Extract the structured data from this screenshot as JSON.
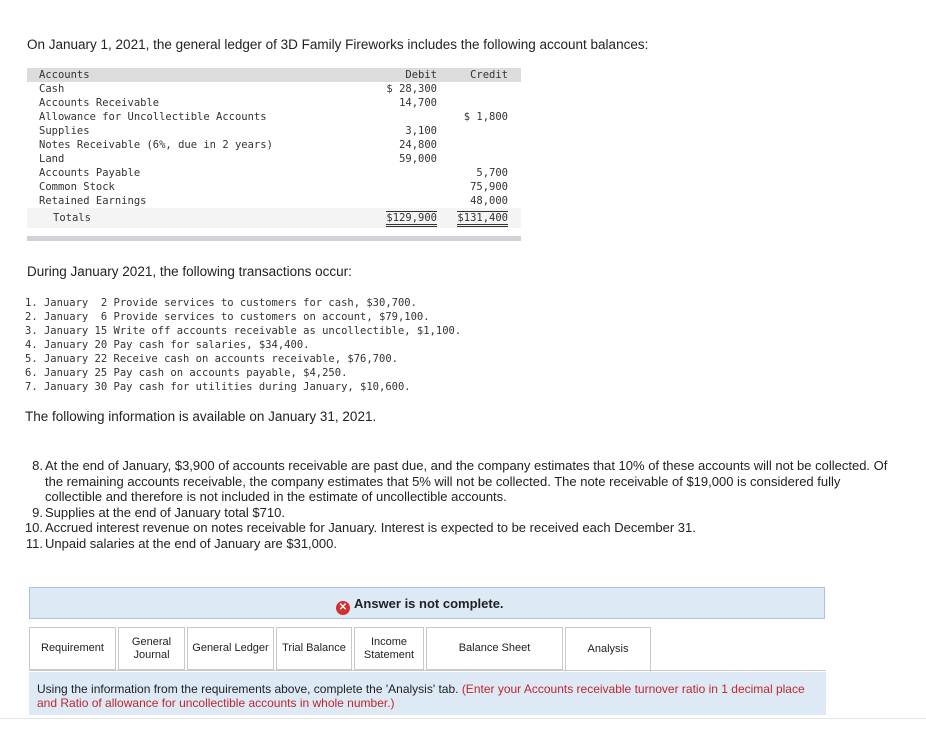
{
  "intro": "On January 1, 2021, the general ledger of 3D Family Fireworks includes the following account balances:",
  "ledger": {
    "headers": {
      "accounts": "Accounts",
      "debit": "Debit",
      "credit": "Credit"
    },
    "rows": [
      {
        "account": "Cash",
        "debit": "$ 28,300",
        "credit": ""
      },
      {
        "account": "Accounts Receivable",
        "debit": "14,700",
        "credit": ""
      },
      {
        "account": "Allowance for Uncollectible Accounts",
        "debit": "",
        "credit": "$  1,800"
      },
      {
        "account": "Supplies",
        "debit": "3,100",
        "credit": ""
      },
      {
        "account": "Notes Receivable (6%, due in 2 years)",
        "debit": "24,800",
        "credit": ""
      },
      {
        "account": "Land",
        "debit": "59,000",
        "credit": ""
      },
      {
        "account": "Accounts Payable",
        "debit": "",
        "credit": "5,700"
      },
      {
        "account": "Common Stock",
        "debit": "",
        "credit": "75,900"
      },
      {
        "account": "Retained Earnings",
        "debit": "",
        "credit": "48,000"
      }
    ],
    "totals": {
      "label": "Totals",
      "debit": "$129,900",
      "credit": "$131,400"
    }
  },
  "during": "During January 2021, the following transactions occur:",
  "transactions": [
    "1. January  2 Provide services to customers for cash, $30,700.",
    "2. January  6 Provide services to customers on account, $79,100.",
    "3. January 15 Write off accounts receivable as uncollectible, $1,100.",
    "4. January 20 Pay cash for salaries, $34,400.",
    "5. January 22 Receive cash on accounts receivable, $76,700.",
    "6. January 25 Pay cash on accounts payable, $4,250.",
    "7. January 30 Pay cash for utilities during January, $10,600."
  ],
  "following": "The following information is available on January 31, 2021.",
  "info_items": [
    {
      "num": "8.",
      "text": "At the end of January, $3,900 of accounts receivable are past due, and the company estimates that 10% of these accounts will not be collected. Of the remaining accounts receivable, the company estimates that 5% will not be collected. The note receivable of $19,000 is considered fully collectible and therefore is not included in the estimate of uncollectible accounts."
    },
    {
      "num": "9.",
      "text": "Supplies at the end of January total $710."
    },
    {
      "num": "10.",
      "text": "Accrued interest revenue on notes receivable for January. Interest is expected to be received each December 31."
    },
    {
      "num": "11.",
      "text": "Unpaid salaries at the end of January are $31,000."
    }
  ],
  "answer_status": "Answer is not complete.",
  "tabs": [
    {
      "label": "Requirement"
    },
    {
      "label": "General Journal"
    },
    {
      "label": "General Ledger"
    },
    {
      "label": "Trial Balance"
    },
    {
      "label": "Income Statement"
    },
    {
      "label": "Balance Sheet"
    },
    {
      "label": "Analysis"
    }
  ],
  "active_tab": "Analysis",
  "instructions": {
    "main": "Using the information from the requirements above, complete the 'Analysis' tab.",
    "note": "(Enter your Accounts receivable turnover ratio in 1 decimal place and Ratio of allowance for uncollectible accounts in whole number.)"
  },
  "colors": {
    "status_icon": "#d32f2f",
    "note_text": "#c0272d",
    "panel_bg": "#dde9f5"
  }
}
